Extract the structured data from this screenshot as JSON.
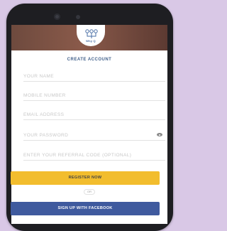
{
  "app": {
    "logo_text": "Why Q",
    "logo_icon": "tri-pin-icon"
  },
  "form": {
    "title": "CREATE ACCOUNT",
    "fields": [
      {
        "name": "name-input",
        "placeholder": "YOUR NAME"
      },
      {
        "name": "mobile-number-input",
        "placeholder": "MOBILE NUMBER"
      },
      {
        "name": "email-input",
        "placeholder": "EMAIL ADDRESS"
      },
      {
        "name": "password-input",
        "placeholder": "YOUR PASSWORD",
        "icon": "eye-icon"
      },
      {
        "name": "referral-code-input",
        "placeholder": "ENTER YOUR REFERRAL CODE (OPTIONAL)"
      }
    ],
    "register_label": "REGISTER NOW",
    "or_label": "OR",
    "facebook_label": "SIGN UP WITH FACEBOOK"
  },
  "colors": {
    "background": "#d9c8e6",
    "accent_yellow": "#f2bd2e",
    "facebook_blue": "#3f5a9e",
    "title_blue": "#3f5f8a"
  }
}
